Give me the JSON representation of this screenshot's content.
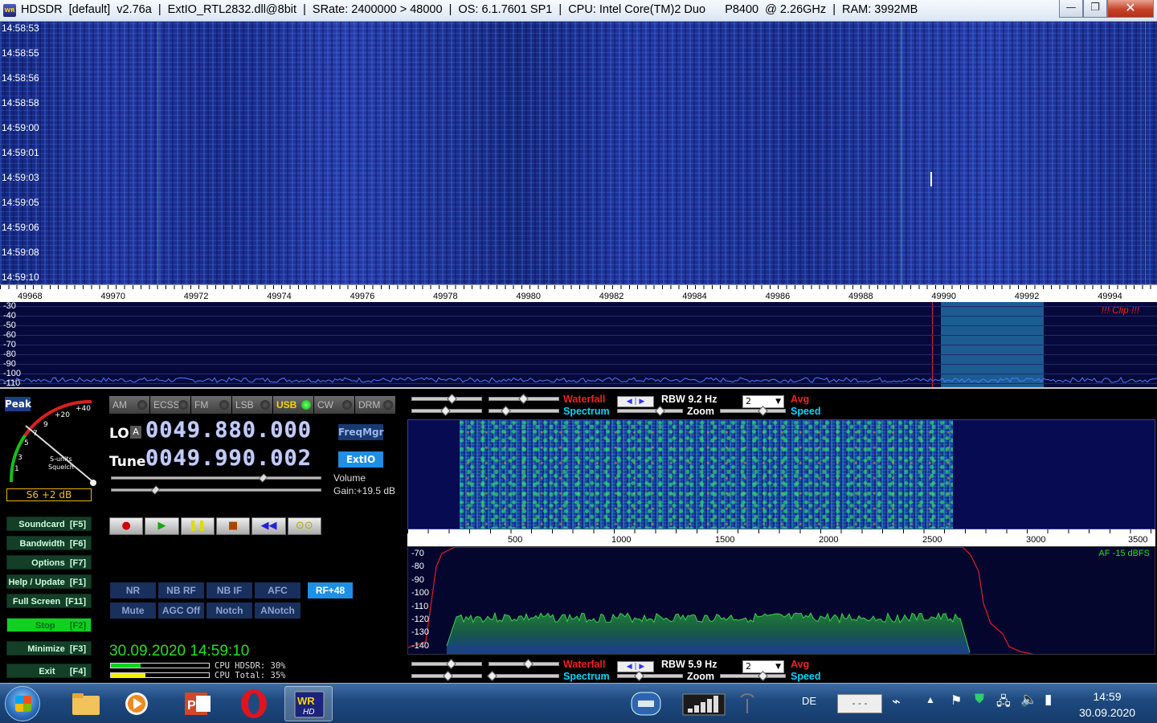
{
  "window": {
    "title": "HDSDR  [default]  v2.76a  |  ExtIO_RTL2832.dll@8bit  |  SRate: 2400000 > 48000  |  OS: 6.1.7601 SP1  |  CPU: Intel Core(TM)2 Duo      P8400  @ 2.26GHz  |  RAM: 3992MB",
    "minimize_glyph": "—",
    "maximize_glyph": "❐",
    "close_glyph": "✕"
  },
  "waterfall": {
    "times": [
      "14:58:53",
      "14:58:55",
      "14:58:56",
      "14:58:58",
      "14:59:00",
      "14:59:01",
      "14:59:03",
      "14:59:05",
      "14:59:06",
      "14:59:08",
      "14:59:10"
    ]
  },
  "freq_axis": {
    "ticks": [
      "49968",
      "49970",
      "49972",
      "49974",
      "49976",
      "49978",
      "49980",
      "49982",
      "49984",
      "49986",
      "49988",
      "49990",
      "49992",
      "49994"
    ]
  },
  "spectrum": {
    "db_labels": [
      "-30",
      "-40",
      "-50",
      "-60",
      "-70",
      "-80",
      "-90",
      "-100",
      "-110"
    ],
    "clip_text": "!!! Clip !!!"
  },
  "smeter": {
    "peak_label": "Peak",
    "scale": [
      "1",
      "3",
      "5",
      "7",
      "9",
      "+20",
      "+40"
    ],
    "caption1": "S-units",
    "caption2": "Squelch",
    "reading": "S6 +2 dB"
  },
  "modes": [
    {
      "label": "AM",
      "selected": false
    },
    {
      "label": "ECSS",
      "selected": false
    },
    {
      "label": "FM",
      "selected": false
    },
    {
      "label": "LSB",
      "selected": false
    },
    {
      "label": "USB",
      "selected": true
    },
    {
      "label": "CW",
      "selected": false
    },
    {
      "label": "DRM",
      "selected": false
    }
  ],
  "lo": {
    "label": "LO",
    "badge": "A",
    "value": "0049.880.000"
  },
  "tune": {
    "label": "Tune",
    "value": "0049.990.002"
  },
  "freqmgr_label": "FreqMgr",
  "extio_label": "ExtIO",
  "volume": {
    "label": "Volume",
    "gain": "Gain:+19.5 dB"
  },
  "function_buttons": [
    {
      "label": "Soundcard  [F5]",
      "on": false
    },
    {
      "label": "Bandwidth  [F6]",
      "on": false
    },
    {
      "label": "Options  [F7]",
      "on": false
    },
    {
      "label": "Help / Update  [F1]",
      "on": false
    },
    {
      "label": "Full Screen  [F11]",
      "on": false
    },
    {
      "label": "Stop      [F2]",
      "on": true
    },
    {
      "label": "Minimize  [F3]",
      "on": false
    },
    {
      "label": "Exit      [F4]",
      "on": false
    }
  ],
  "recorder": [
    "●",
    "▶",
    "❚❚",
    "■",
    "◀◀",
    "⊙⊙"
  ],
  "dsp_row1": [
    "NR",
    "NB RF",
    "NB IF",
    "AFC",
    "RF+48"
  ],
  "dsp_row2": [
    "Mute",
    "AGC Off",
    "Notch",
    "ANotch"
  ],
  "datetime": "30.09.2020 14:59:10",
  "cpu": {
    "hdsdr_text": "CPU HDSDR: 30%",
    "total_text": "CPU Total: 35%",
    "hdsdr_pct": 30,
    "total_pct": 35,
    "hdsdr_color": "#10d020",
    "total_color": "#f0f000"
  },
  "rf_controls": {
    "waterfall": "Waterfall",
    "spectrum": "Spectrum",
    "rbw": "RBW  9.2 Hz",
    "zoom": "Zoom",
    "avg": "Avg",
    "speed": "Speed",
    "dropdown": "2",
    "arrows": "◀ | ▶"
  },
  "af_controls": {
    "waterfall": "Waterfall",
    "spectrum": "Spectrum",
    "rbw": "RBW  5.9 Hz",
    "zoom": "Zoom",
    "avg": "Avg",
    "speed": "Speed",
    "dropdown": "2",
    "arrows": "◀ | ▶"
  },
  "af_axis": {
    "ticks": [
      "500",
      "1000",
      "1500",
      "2000",
      "2500",
      "3000",
      "3500"
    ]
  },
  "af_spectrum": {
    "db_labels": [
      "-70",
      "-80",
      "-90",
      "-100",
      "-110",
      "-120",
      "-130",
      "-140"
    ],
    "level": "AF -15 dBFS"
  },
  "taskbar": {
    "lang": "DE",
    "clock_time": "14:59",
    "clock_date": "30.09.2020",
    "tray_dashes": "- - -",
    "apps": [
      "explorer-app",
      "media-player-app",
      "powerpoint-app",
      "opera-app",
      "hdsdr-app"
    ]
  }
}
